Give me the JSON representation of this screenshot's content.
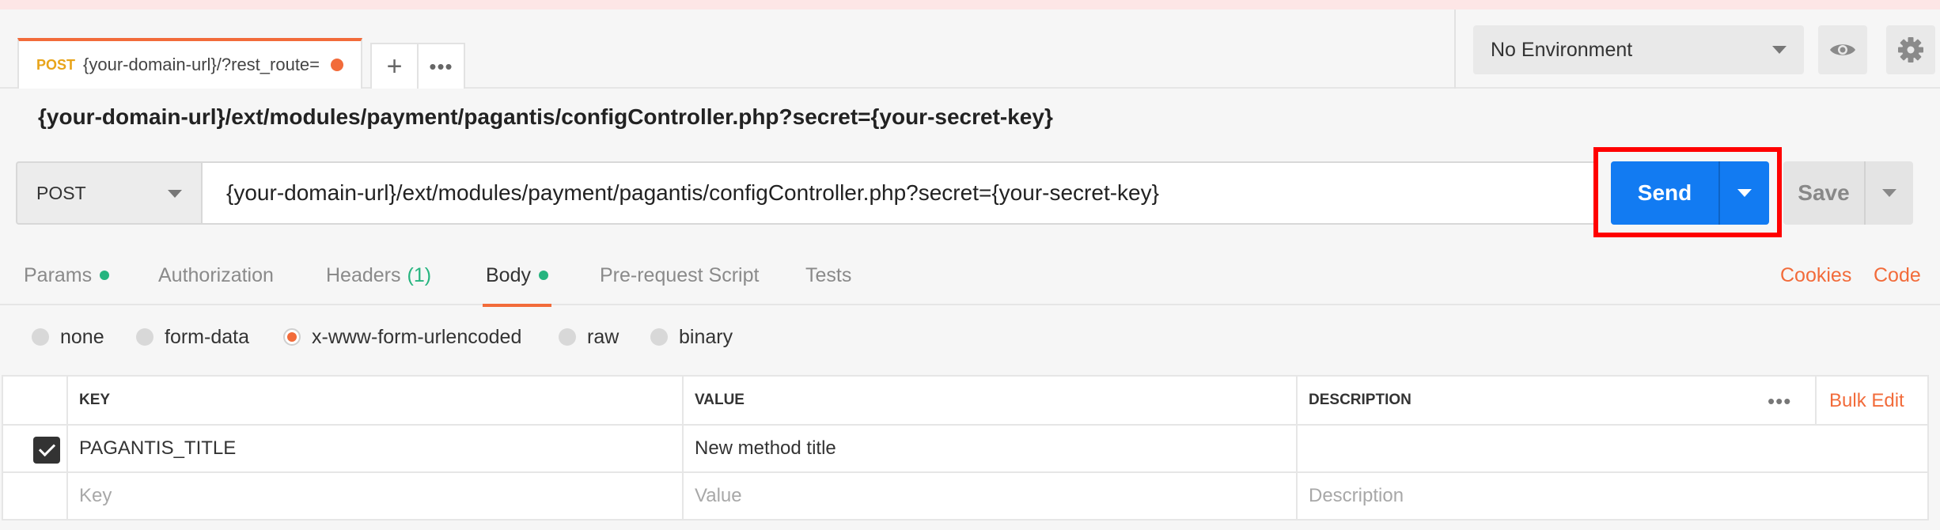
{
  "tab": {
    "method": "POST",
    "title": "{your-domain-url}/?rest_route="
  },
  "tab_buttons": {
    "new": "+",
    "more": "•••"
  },
  "environment": {
    "selected": "No Environment"
  },
  "request": {
    "title": "{your-domain-url}/ext/modules/payment/pagantis/configController.php?secret={your-secret-key}",
    "method": "POST",
    "url": "{your-domain-url}/ext/modules/payment/pagantis/configController.php?secret={your-secret-key}"
  },
  "buttons": {
    "send": "Send",
    "save": "Save"
  },
  "subtabs": {
    "params": "Params",
    "authorization": "Authorization",
    "headers": "Headers",
    "headers_count": "(1)",
    "body": "Body",
    "prerequest": "Pre-request Script",
    "tests": "Tests",
    "cookies": "Cookies",
    "code": "Code"
  },
  "body_modes": [
    "none",
    "form-data",
    "x-www-form-urlencoded",
    "raw",
    "binary"
  ],
  "body_mode_selected": "x-www-form-urlencoded",
  "table": {
    "headers": {
      "key": "KEY",
      "value": "VALUE",
      "description": "DESCRIPTION"
    },
    "bulk_edit": "Bulk Edit",
    "more": "•••",
    "rows": [
      {
        "key": "PAGANTIS_TITLE",
        "value": "New method title",
        "description": "",
        "checked": true
      }
    ],
    "placeholders": {
      "key": "Key",
      "value": "Value",
      "description": "Description"
    }
  },
  "colors": {
    "accent": "#f26b3a",
    "send": "#127bf2",
    "highlight": "#ff0000",
    "dot_green": "#26b47f"
  }
}
